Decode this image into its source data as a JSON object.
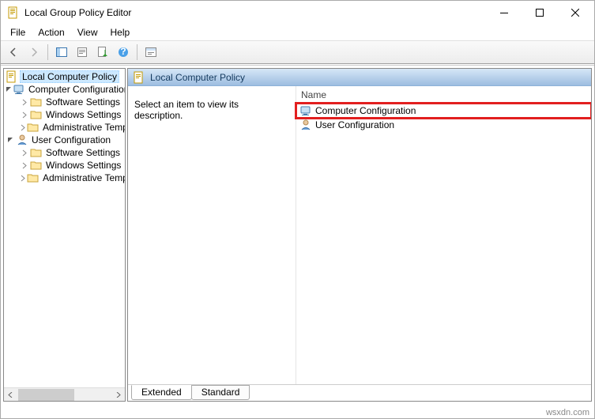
{
  "window": {
    "title": "Local Group Policy Editor"
  },
  "menu": {
    "file": "File",
    "action": "Action",
    "view": "View",
    "help": "Help"
  },
  "tree": {
    "root": "Local Computer Policy",
    "computer_config": "Computer Configuration",
    "cc_software": "Software Settings",
    "cc_windows": "Windows Settings",
    "cc_admin": "Administrative Templates",
    "user_config": "User Configuration",
    "uc_software": "Software Settings",
    "uc_windows": "Windows Settings",
    "uc_admin": "Administrative Templates"
  },
  "content": {
    "header": "Local Computer Policy",
    "description_prompt": "Select an item to view its description.",
    "column_name": "Name",
    "row_computer": "Computer Configuration",
    "row_user": "User Configuration",
    "tab_extended": "Extended",
    "tab_standard": "Standard"
  },
  "footer": {
    "watermark": "wsxdn.com"
  }
}
